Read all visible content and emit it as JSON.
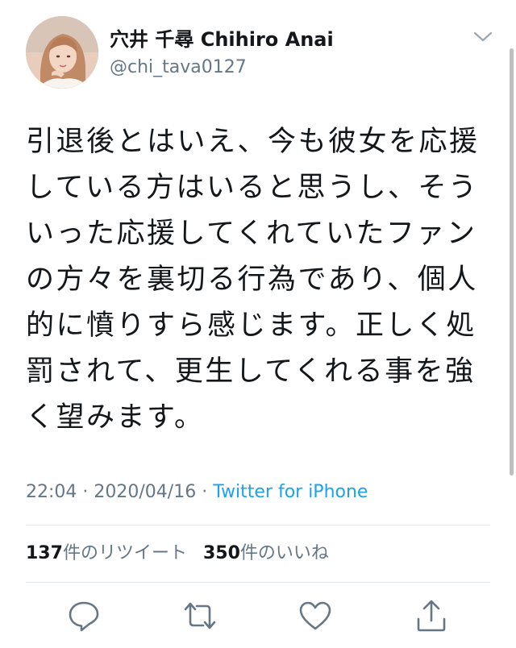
{
  "tweet": {
    "author_name": "穴井 千尋 Chihiro Anai",
    "author_handle": "@chi_tava0127",
    "text_lines": [
      "引退後とはいえ、今も彼女を応援",
      "している方はいると思うし、そう",
      "いった応援してくれていたファン",
      "の方々を裏切る行為であり、個人",
      "的に憤りすら感じます。正しく処",
      "罰されて、更生してくれる事を強",
      "く望みます。"
    ],
    "time": "22:04",
    "separator": "·",
    "date": "2020/04/16",
    "source": "Twitter for iPhone",
    "retweet_count": "137",
    "retweet_label": "件のリツイート",
    "like_count": "350",
    "like_label": "件のいいね"
  },
  "colors": {
    "text": "#14171a",
    "muted": "#657786",
    "link": "#1da1f2",
    "divider": "#e1e8ed",
    "icon": "#657786"
  },
  "icons": {
    "more": "chevron-down-icon",
    "reply": "reply-icon",
    "retweet": "retweet-icon",
    "like": "heart-icon",
    "share": "share-icon"
  }
}
